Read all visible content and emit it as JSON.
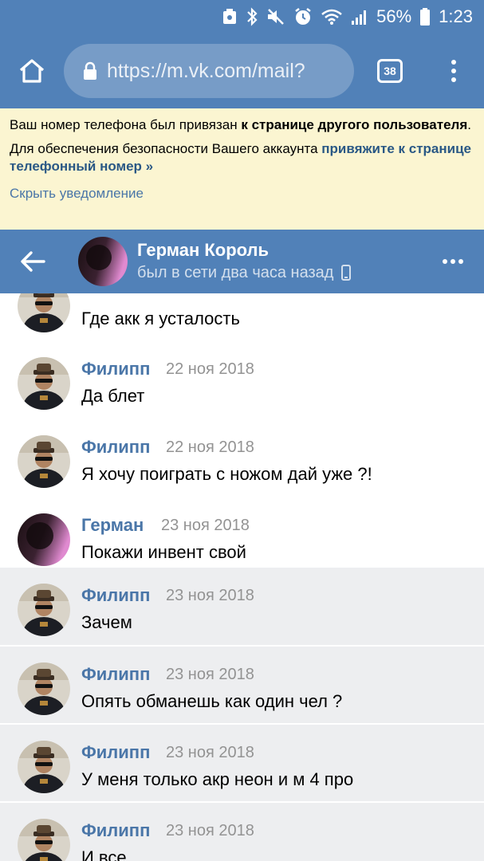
{
  "status_bar": {
    "battery": "56%",
    "time": "1:23"
  },
  "browser": {
    "url": "https://m.vk.com/mail?",
    "tab_count": "38"
  },
  "notice": {
    "line1_prefix": "Ваш номер телефона был привязан ",
    "line1_bold": "к странице другого пользователя",
    "line1_suffix": ".",
    "line2_prefix": "Для обеспечения безопасности Вашего аккаунта ",
    "line2_link": "привяжите к странице телефонный номер »",
    "hide_link": "Скрыть уведомление"
  },
  "chat": {
    "name": "Герман Король",
    "status": "был в сети два часа назад"
  },
  "messages": [
    {
      "author": "",
      "date": "",
      "text": "Где акк я усталость",
      "unread": false
    },
    {
      "author": "Филипп",
      "date": "22 ноя 2018",
      "text": "Да блет",
      "unread": false
    },
    {
      "author": "Филипп",
      "date": "22 ноя 2018",
      "text": "Я хочу поиграть с ножом дай уже ?!",
      "unread": false
    },
    {
      "author": "Герман",
      "date": "23 ноя 2018",
      "text": "Покажи инвент свой",
      "unread": false
    },
    {
      "author": "Филипп",
      "date": "23 ноя 2018",
      "text": "Зачем",
      "unread": true
    },
    {
      "author": "Филипп",
      "date": "23 ноя 2018",
      "text": "Опять обманешь как один чел ?",
      "unread": true
    },
    {
      "author": "Филипп",
      "date": "23 ноя 2018",
      "text": "У меня только акр неон и м 4 про",
      "unread": true
    },
    {
      "author": "Филипп",
      "date": "23 ноя 2018",
      "text": "И все",
      "unread": true
    }
  ],
  "colors": {
    "vk_blue": "#5181b8",
    "link": "#4a76a8",
    "notice_bg": "#fbf5d1",
    "unread_bg": "#edeef0"
  }
}
